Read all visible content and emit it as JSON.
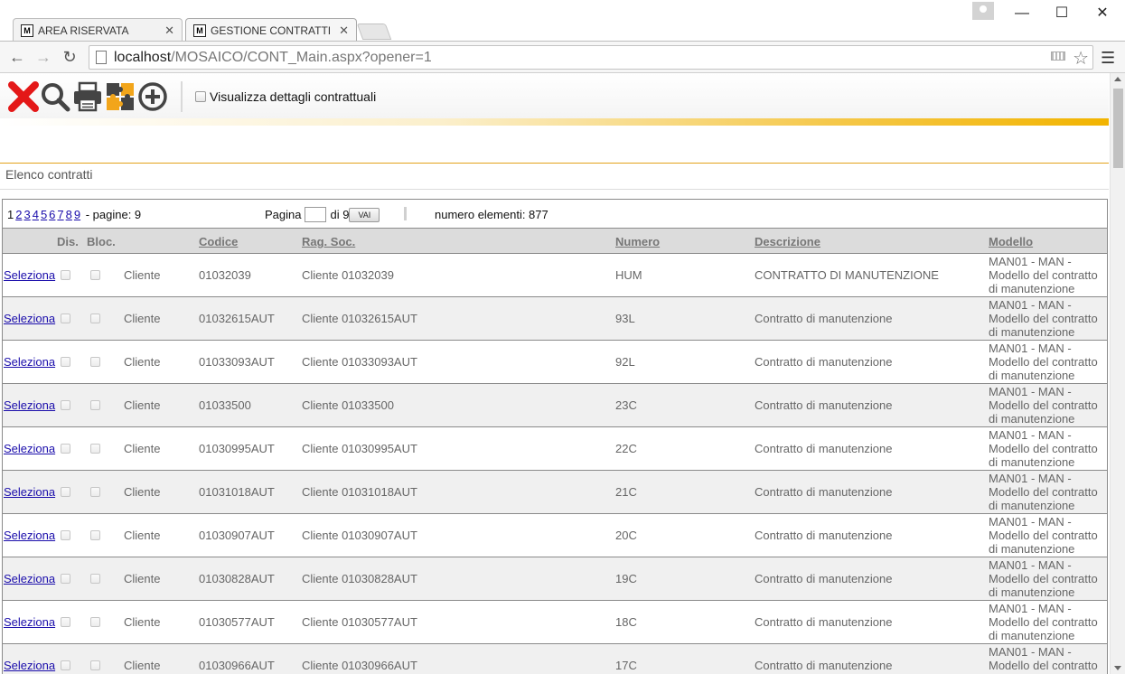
{
  "browser": {
    "tabs": [
      {
        "label": "AREA RISERVATA",
        "favicon": "M",
        "active": false
      },
      {
        "label": "GESTIONE CONTRATTI",
        "favicon": "M",
        "active": true
      }
    ],
    "url_host": "localhost",
    "url_path": "/MOSAICO/CONT_Main.aspx?opener=1",
    "window_controls": {
      "minimize": "—",
      "maximize": "☐",
      "close": "✕"
    }
  },
  "toolbar": {
    "checkbox_label": "Visualizza dettagli contrattuali",
    "icons": [
      "close-red-x-icon",
      "search-icon",
      "print-icon",
      "puzzle-icon",
      "add-circle-icon"
    ]
  },
  "section": {
    "title": "Elenco contratti"
  },
  "pager": {
    "pages": [
      "1",
      "2",
      "3",
      "4",
      "5",
      "6",
      "7",
      "8",
      "9"
    ],
    "current_page": "1",
    "pages_text": "- pagine: 9",
    "pagina_label": "Pagina",
    "di_label": "di 9",
    "go_button": "VAI",
    "count_text": "numero elementi: 877"
  },
  "columns": {
    "dis": "Dis.",
    "bloc": "Bloc.",
    "codice": "Codice",
    "rag_soc": "Rag. Soc.",
    "numero": "Numero",
    "descrizione": "Descrizione",
    "modello": "Modello"
  },
  "select_label": "Seleziona",
  "rows": [
    {
      "tipo": "Cliente",
      "codice": "01032039",
      "rag_soc": "Cliente 01032039",
      "numero": "HUM",
      "descrizione": "CONTRATTO DI MANUTENZIONE",
      "modello": "MAN01 - MAN - Modello del contratto di manutenzione"
    },
    {
      "tipo": "Cliente",
      "codice": "01032615AUT",
      "rag_soc": "Cliente 01032615AUT",
      "numero": "93L",
      "descrizione": "Contratto di manutenzione",
      "modello": "MAN01 - MAN - Modello del contratto di manutenzione"
    },
    {
      "tipo": "Cliente",
      "codice": "01033093AUT",
      "rag_soc": "Cliente 01033093AUT",
      "numero": "92L",
      "descrizione": "Contratto di manutenzione",
      "modello": "MAN01 - MAN - Modello del contratto di manutenzione"
    },
    {
      "tipo": "Cliente",
      "codice": "01033500",
      "rag_soc": "Cliente 01033500",
      "numero": "23C",
      "descrizione": "Contratto di manutenzione",
      "modello": "MAN01 - MAN - Modello del contratto di manutenzione"
    },
    {
      "tipo": "Cliente",
      "codice": "01030995AUT",
      "rag_soc": "Cliente 01030995AUT",
      "numero": "22C",
      "descrizione": "Contratto di manutenzione",
      "modello": "MAN01 - MAN - Modello del contratto di manutenzione"
    },
    {
      "tipo": "Cliente",
      "codice": "01031018AUT",
      "rag_soc": "Cliente 01031018AUT",
      "numero": "21C",
      "descrizione": "Contratto di manutenzione",
      "modello": "MAN01 - MAN - Modello del contratto di manutenzione"
    },
    {
      "tipo": "Cliente",
      "codice": "01030907AUT",
      "rag_soc": "Cliente 01030907AUT",
      "numero": "20C",
      "descrizione": "Contratto di manutenzione",
      "modello": "MAN01 - MAN - Modello del contratto di manutenzione"
    },
    {
      "tipo": "Cliente",
      "codice": "01030828AUT",
      "rag_soc": "Cliente 01030828AUT",
      "numero": "19C",
      "descrizione": "Contratto di manutenzione",
      "modello": "MAN01 - MAN - Modello del contratto di manutenzione"
    },
    {
      "tipo": "Cliente",
      "codice": "01030577AUT",
      "rag_soc": "Cliente 01030577AUT",
      "numero": "18C",
      "descrizione": "Contratto di manutenzione",
      "modello": "MAN01 - MAN - Modello del contratto di manutenzione"
    },
    {
      "tipo": "Cliente",
      "codice": "01030966AUT",
      "rag_soc": "Cliente 01030966AUT",
      "numero": "17C",
      "descrizione": "Contratto di manutenzione",
      "modello": "MAN01 - MAN - Modello del contratto di manutenzione"
    }
  ]
}
